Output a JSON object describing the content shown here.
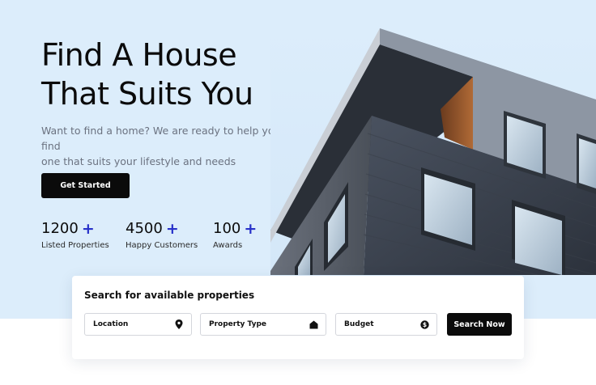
{
  "hero": {
    "title_line1": "Find A House",
    "title_line2": "That Suits You",
    "subtitle_line1": "Want to find a home? We are ready to help you find",
    "subtitle_line2": "one that suits your lifestyle and needs",
    "cta_label": "Get Started"
  },
  "stats": [
    {
      "value": "1200",
      "plus": "+",
      "label": "Listed Properties"
    },
    {
      "value": "4500",
      "plus": "+",
      "label": "Happy Customers"
    },
    {
      "value": "100",
      "plus": "+",
      "label": "Awards"
    }
  ],
  "search": {
    "title": "Search for available properties",
    "fields": [
      {
        "label": "Location",
        "icon": "map-pin-icon"
      },
      {
        "label": "Property Type",
        "icon": "house-icon"
      },
      {
        "label": "Budget",
        "icon": "dollar-coin-icon"
      }
    ],
    "button_label": "Search Now"
  },
  "colors": {
    "hero_background": "#dcedfb",
    "primary_button": "#0b0b0b",
    "plus_accent": "#2731c9"
  }
}
